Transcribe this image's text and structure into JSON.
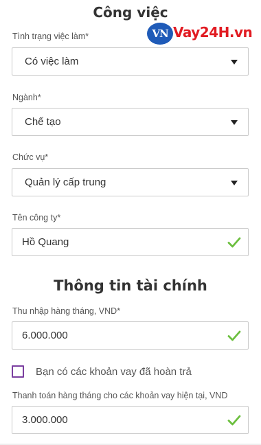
{
  "work": {
    "title": "Công việc",
    "employment_status": {
      "label": "Tình trạng việc làm*",
      "value": "Có việc làm"
    },
    "industry": {
      "label": "Ngành*",
      "value": "Chế tạo"
    },
    "position": {
      "label": "Chức vụ*",
      "value": "Quản lý cấp trung"
    },
    "company": {
      "label": "Tên công ty*",
      "value": "Hồ Quang"
    }
  },
  "finance": {
    "title": "Thông tin tài chính",
    "monthly_income": {
      "label": "Thu nhập hàng tháng, VND*",
      "value": "6.000.000"
    },
    "repaid_loans": {
      "label": "Bạn có các khoản vay đã hoàn trả",
      "checked": false
    },
    "monthly_payment": {
      "label": "Thanh toán hàng tháng cho các khoản vay hiện tại, VND",
      "value": "3.000.000"
    }
  },
  "logo": {
    "badge": "VN",
    "text": "Vay24H.vn"
  },
  "colors": {
    "check": "#6cbf3f",
    "checkbox_border": "#7b3fa0",
    "logo_blue": "#1f5bb8",
    "logo_red": "#e11b22"
  },
  "icons": {
    "dropdown": "caret-down-icon",
    "valid": "check-icon"
  }
}
